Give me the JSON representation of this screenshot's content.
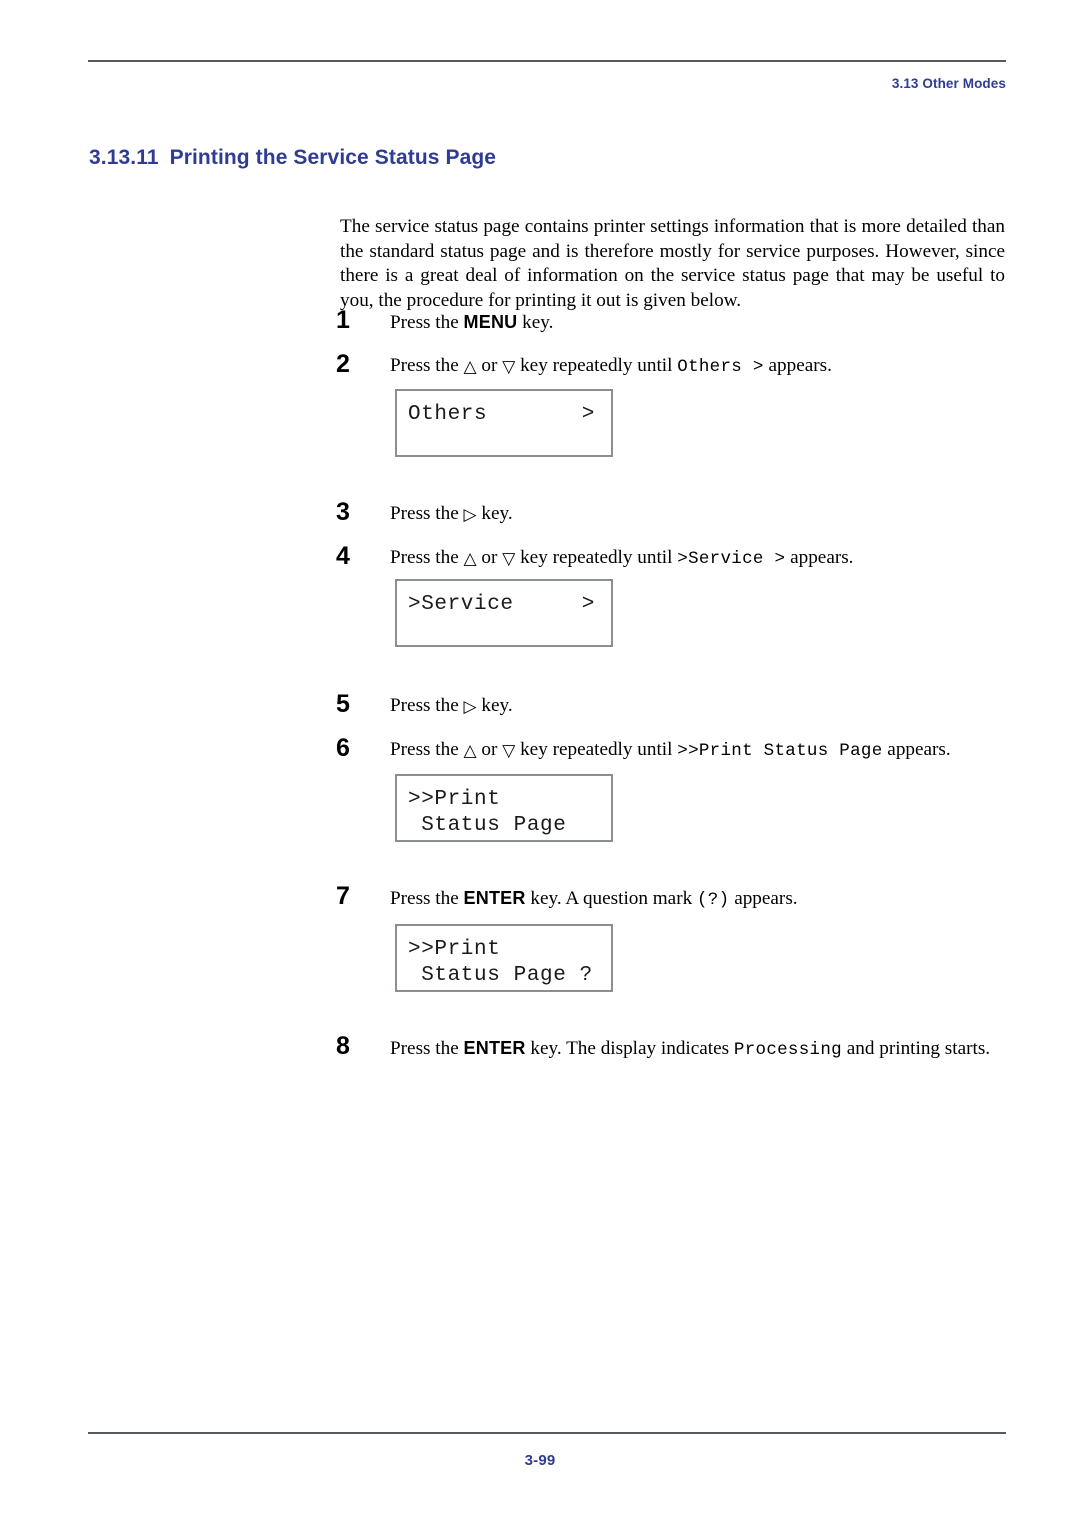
{
  "header": {
    "running_head": "3.13 Other Modes"
  },
  "heading": {
    "number": "3.13.11",
    "title": "Printing the Service Status Page"
  },
  "intro": {
    "paragraph": "The service status page contains printer settings information that is more detailed than the standard status page and is therefore mostly for service purposes. However, since there is a great deal of information on the service status page that may be useful to you, the procedure for printing it out is given below."
  },
  "steps": [
    {
      "number": "1",
      "parts": [
        {
          "type": "text",
          "value": "Press the "
        },
        {
          "type": "kbd",
          "value": "MENU"
        },
        {
          "type": "text",
          "value": " key."
        }
      ]
    },
    {
      "number": "2",
      "parts": [
        {
          "type": "text",
          "value": "Press the "
        },
        {
          "type": "tri",
          "value": "△"
        },
        {
          "type": "text",
          "value": " or "
        },
        {
          "type": "tri",
          "value": "▽"
        },
        {
          "type": "text",
          "value": " key repeatedly until "
        },
        {
          "type": "mono",
          "value": "Others >"
        },
        {
          "type": "text",
          "value": " appears."
        }
      ]
    },
    {
      "number": "3",
      "parts": [
        {
          "type": "text",
          "value": "Press the "
        },
        {
          "type": "tri",
          "value": "▷"
        },
        {
          "type": "text",
          "value": " key."
        }
      ]
    },
    {
      "number": "4",
      "parts": [
        {
          "type": "text",
          "value": "Press the "
        },
        {
          "type": "tri",
          "value": "△"
        },
        {
          "type": "text",
          "value": " or "
        },
        {
          "type": "tri",
          "value": "▽"
        },
        {
          "type": "text",
          "value": " key repeatedly until "
        },
        {
          "type": "mono",
          "value": ">Service >"
        },
        {
          "type": "text",
          "value": " appears."
        }
      ]
    },
    {
      "number": "5",
      "parts": [
        {
          "type": "text",
          "value": "Press the "
        },
        {
          "type": "tri",
          "value": "▷"
        },
        {
          "type": "text",
          "value": " key."
        }
      ]
    },
    {
      "number": "6",
      "parts": [
        {
          "type": "text",
          "value": "Press the "
        },
        {
          "type": "tri",
          "value": "△"
        },
        {
          "type": "text",
          "value": " or "
        },
        {
          "type": "tri",
          "value": "▽"
        },
        {
          "type": "text",
          "value": " key repeatedly until "
        },
        {
          "type": "mono",
          "value": ">>Print Status Page"
        },
        {
          "type": "text",
          "value": " appears."
        }
      ]
    },
    {
      "number": "7",
      "parts": [
        {
          "type": "text",
          "value": "Press the "
        },
        {
          "type": "kbd",
          "value": "ENTER"
        },
        {
          "type": "text",
          "value": " key. A question mark "
        },
        {
          "type": "mono",
          "value": "(?)"
        },
        {
          "type": "text",
          "value": " appears."
        }
      ]
    },
    {
      "number": "8",
      "parts": [
        {
          "type": "text",
          "value": "Press the "
        },
        {
          "type": "kbd",
          "value": "ENTER"
        },
        {
          "type": "text",
          "value": " key. The display indicates "
        },
        {
          "type": "mono",
          "value": "Processing"
        },
        {
          "type": "text",
          "value": " and printing starts."
        }
      ]
    }
  ],
  "lcd_displays": [
    {
      "name": "others-display",
      "left_text": "Others",
      "right_text": ">",
      "second_line": ""
    },
    {
      "name": "service-display",
      "left_text": ">Service",
      "right_text": ">",
      "second_line": ""
    },
    {
      "name": "print-status-page-display",
      "left_text": ">>Print",
      "right_text": "",
      "second_line": " Status Page"
    },
    {
      "name": "print-status-page-confirm-display",
      "left_text": ">>Print",
      "right_text": "",
      "second_line": " Status Page ?"
    }
  ],
  "footer": {
    "page_number": "3-99"
  },
  "colors": {
    "accent_blue": "#2f3c93",
    "rule_gray": "#555b5e",
    "lcd_border": "#8a8f92"
  }
}
